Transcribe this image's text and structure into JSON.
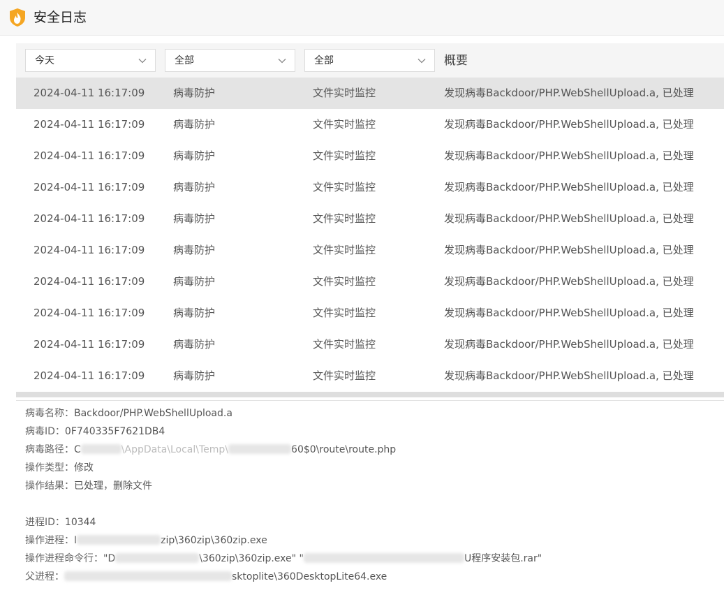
{
  "app": {
    "title": "安全日志"
  },
  "filters": {
    "date": "今天",
    "category": "全部",
    "source": "全部",
    "summary_header": "概要"
  },
  "rows": [
    {
      "time": "2024-04-11 16:17:09",
      "type": "病毒防护",
      "module": "文件实时监控",
      "summary": "发现病毒Backdoor/PHP.WebShellUpload.a, 已处理",
      "selected": true
    },
    {
      "time": "2024-04-11 16:17:09",
      "type": "病毒防护",
      "module": "文件实时监控",
      "summary": "发现病毒Backdoor/PHP.WebShellUpload.a, 已处理"
    },
    {
      "time": "2024-04-11 16:17:09",
      "type": "病毒防护",
      "module": "文件实时监控",
      "summary": "发现病毒Backdoor/PHP.WebShellUpload.a, 已处理"
    },
    {
      "time": "2024-04-11 16:17:09",
      "type": "病毒防护",
      "module": "文件实时监控",
      "summary": "发现病毒Backdoor/PHP.WebShellUpload.a, 已处理"
    },
    {
      "time": "2024-04-11 16:17:09",
      "type": "病毒防护",
      "module": "文件实时监控",
      "summary": "发现病毒Backdoor/PHP.WebShellUpload.a, 已处理"
    },
    {
      "time": "2024-04-11 16:17:09",
      "type": "病毒防护",
      "module": "文件实时监控",
      "summary": "发现病毒Backdoor/PHP.WebShellUpload.a, 已处理"
    },
    {
      "time": "2024-04-11 16:17:09",
      "type": "病毒防护",
      "module": "文件实时监控",
      "summary": "发现病毒Backdoor/PHP.WebShellUpload.a, 已处理"
    },
    {
      "time": "2024-04-11 16:17:09",
      "type": "病毒防护",
      "module": "文件实时监控",
      "summary": "发现病毒Backdoor/PHP.WebShellUpload.a, 已处理"
    },
    {
      "time": "2024-04-11 16:17:09",
      "type": "病毒防护",
      "module": "文件实时监控",
      "summary": "发现病毒Backdoor/PHP.WebShellUpload.a, 已处理"
    },
    {
      "time": "2024-04-11 16:17:09",
      "type": "病毒防护",
      "module": "文件实时监控",
      "summary": "发现病毒Backdoor/PHP.WebShellUpload.a, 已处理"
    }
  ],
  "detail": {
    "virus_name_label": "病毒名称：",
    "virus_name": "Backdoor/PHP.WebShellUpload.a",
    "virus_id_label": "病毒ID：",
    "virus_id": "0F740335F7621DB4",
    "virus_path_label": "病毒路径：",
    "virus_path_a": "C",
    "virus_path_b": "\\AppData\\Local\\Temp\\",
    "virus_path_c": "60$0\\route\\route.php",
    "op_type_label": "操作类型：",
    "op_type": "修改",
    "op_result_label": "操作结果：",
    "op_result": "已处理，删除文件",
    "pid_label": "进程ID：",
    "pid": "10344",
    "process_label": "操作进程：",
    "process_a": "I",
    "process_b": "zip\\360zip\\360zip.exe",
    "cmdline_label": "操作进程命令行：",
    "cmdline_a": "\"D",
    "cmdline_b": "\\360zip\\360zip.exe\" \"",
    "cmdline_c": "U程序安装包.rar\"",
    "parent_label": "父进程：",
    "parent": "sktoplite\\360DesktopLite64.exe"
  },
  "colors": {
    "selected_row": "#e4e4e4",
    "accent": "#f5a623"
  },
  "icons": {
    "app": "shield-flame-icon",
    "dropdown": "chevron-down-icon"
  }
}
